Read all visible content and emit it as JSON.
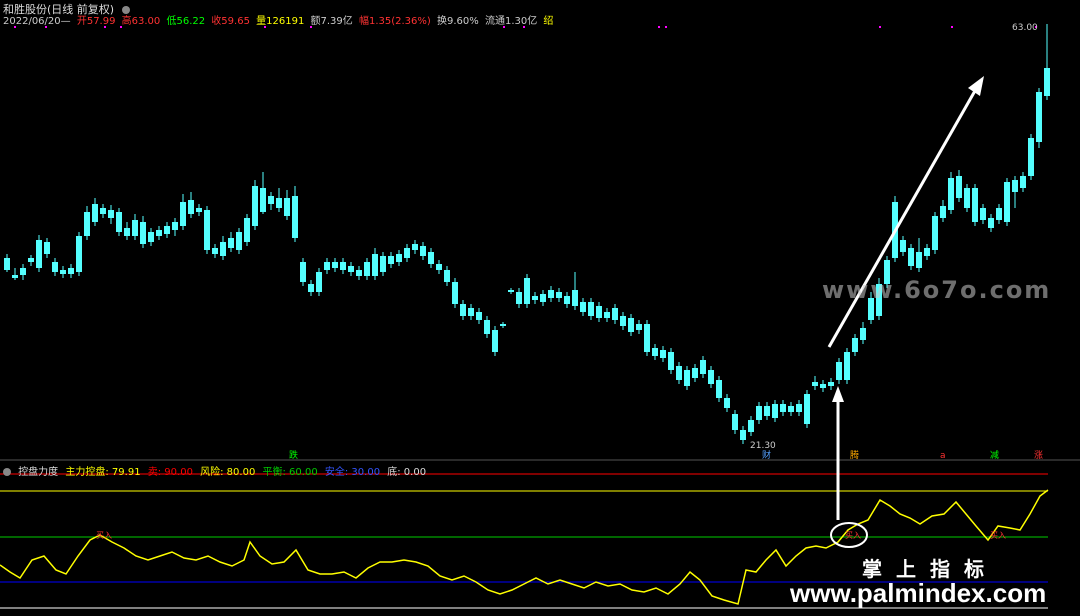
{
  "header": {
    "stock": "和胜股份(日线 前复权)",
    "date": "2022/06/20—",
    "open": "开57.99",
    "high": "高63.00",
    "low": "低56.22",
    "close": "收59.65",
    "vol": "量126191",
    "amount": "额7.39亿",
    "change": "幅1.35(2.36%)",
    "turnover": "换9.60%",
    "float": "流通1.30亿",
    "tag": "绍"
  },
  "indicator": {
    "name": "控盘力度",
    "main": "主力控盘: 79.91",
    "sell": "卖: 90.00",
    "risk": "风险: 80.00",
    "balance": "平衡: 60.00",
    "safe": "安全: 30.00",
    "bottom": "底: 0.00"
  },
  "price_labels": {
    "max": "63.00",
    "min": "21.30"
  },
  "markers": [
    "跌",
    "财",
    "腾",
    "a",
    "减",
    "涨"
  ],
  "buy_labels": [
    "买入",
    "买入",
    "买入"
  ],
  "watermarks": {
    "site1": "www.6o7o.com",
    "brand": "掌上指标",
    "site2": "www.palmindex.com"
  },
  "colors": {
    "up": "#ff3232",
    "down": "#54ffff",
    "line": "#ffff00",
    "sell": "#ff0000",
    "risk": "#ffff00",
    "balance": "#00cc00",
    "safe": "#0000ff"
  }
}
